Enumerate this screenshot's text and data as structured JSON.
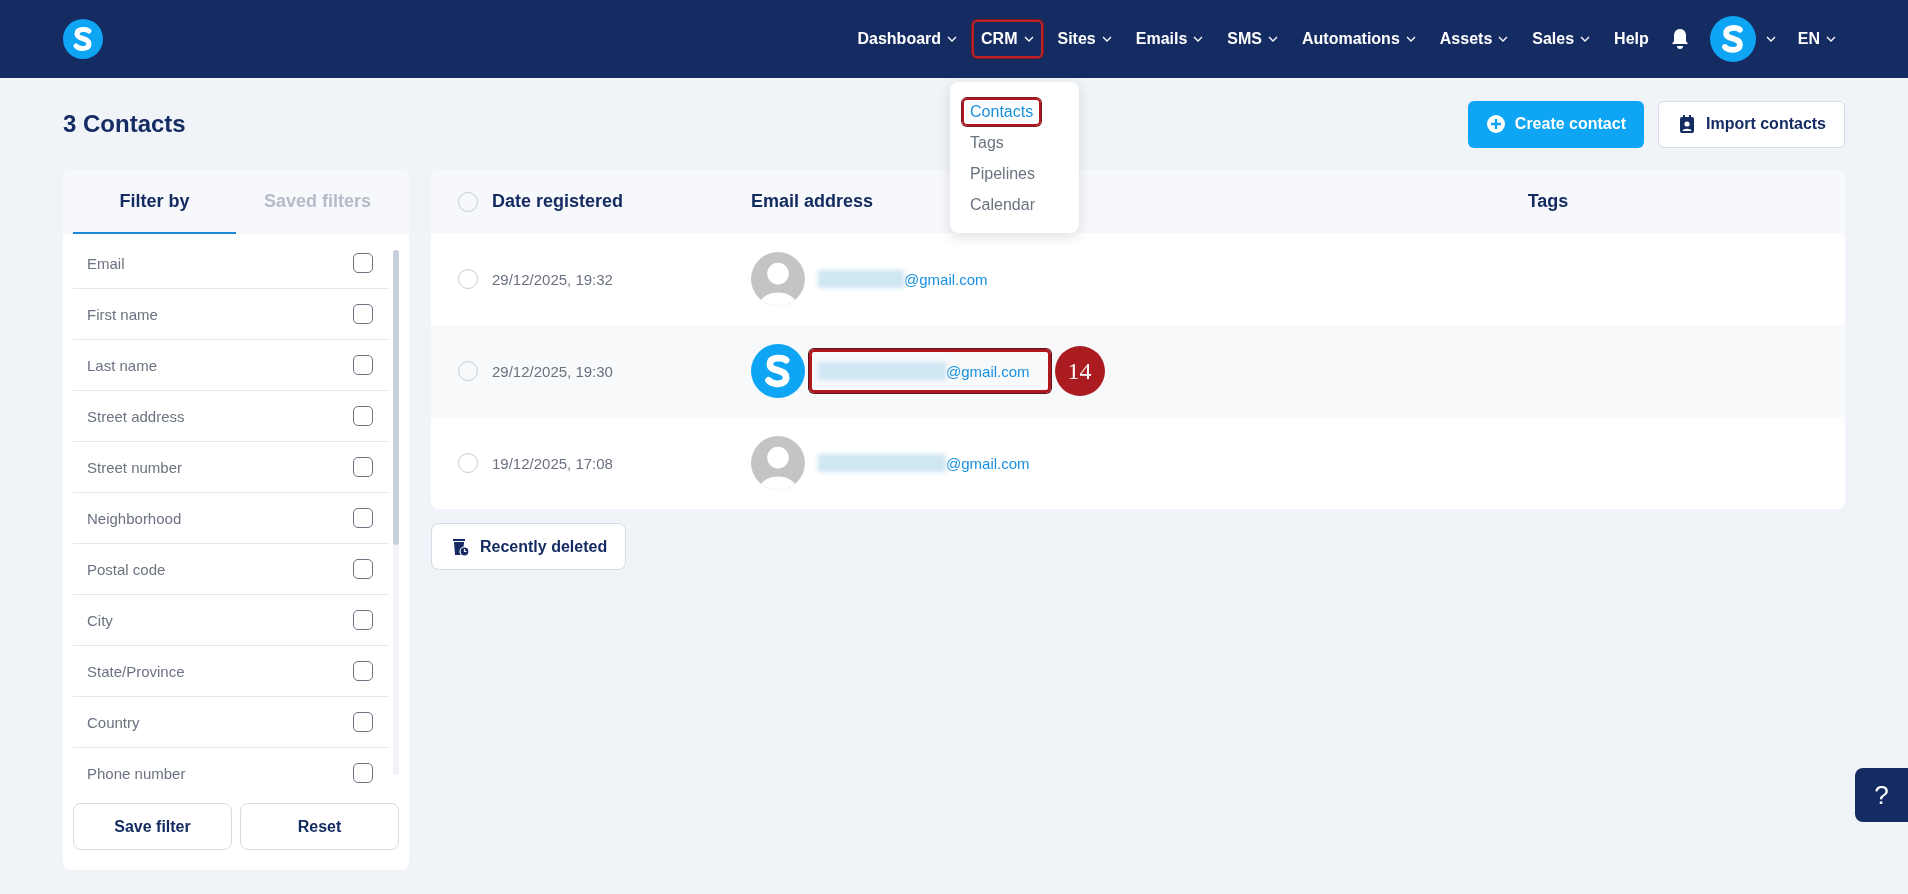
{
  "nav": {
    "items": [
      {
        "label": "Dashboard",
        "kind": "menu",
        "highlighted": false
      },
      {
        "label": "CRM",
        "kind": "menu",
        "highlighted": true
      },
      {
        "label": "Sites",
        "kind": "menu",
        "highlighted": false
      },
      {
        "label": "Emails",
        "kind": "menu",
        "highlighted": false
      },
      {
        "label": "SMS",
        "kind": "menu",
        "highlighted": false
      },
      {
        "label": "Automations",
        "kind": "menu",
        "highlighted": false
      },
      {
        "label": "Assets",
        "kind": "menu",
        "highlighted": false
      },
      {
        "label": "Sales",
        "kind": "menu",
        "highlighted": false
      },
      {
        "label": "Help",
        "kind": "link",
        "highlighted": false
      }
    ],
    "language": "EN"
  },
  "dropdown": {
    "items": [
      {
        "label": "Contacts",
        "selected": true,
        "highlighted": true
      },
      {
        "label": "Tags",
        "selected": false,
        "highlighted": false
      },
      {
        "label": "Pipelines",
        "selected": false,
        "highlighted": false
      },
      {
        "label": "Calendar",
        "selected": false,
        "highlighted": false
      }
    ]
  },
  "page_title": "3 Contacts",
  "buttons": [
    {
      "label": "Create contact",
      "kind": "primary"
    },
    {
      "label": "Import contacts",
      "kind": "secondary"
    }
  ],
  "filter_panel": {
    "tabs": [
      {
        "label": "Filter by",
        "selected": true
      },
      {
        "label": "Saved filters",
        "selected": false
      }
    ],
    "fields": [
      {
        "label": "Email",
        "checked": false
      },
      {
        "label": "First name",
        "checked": false
      },
      {
        "label": "Last name",
        "checked": false
      },
      {
        "label": "Street address",
        "checked": false
      },
      {
        "label": "Street number",
        "checked": false
      },
      {
        "label": "Neighborhood",
        "checked": false
      },
      {
        "label": "Postal code",
        "checked": false
      },
      {
        "label": "City",
        "checked": false
      },
      {
        "label": "State/Province",
        "checked": false
      },
      {
        "label": "Country",
        "checked": false
      },
      {
        "label": "Phone number",
        "checked": false
      }
    ],
    "actions": [
      "Save filter",
      "Reset"
    ]
  },
  "table": {
    "columns": [
      "Date registered",
      "Email address",
      "Tags"
    ],
    "all_selected": false,
    "rows": [
      {
        "date": "29/12/2025, 19:32",
        "kind": "placeholder",
        "email": "@gmail.com",
        "highlighted": false,
        "selected": false
      },
      {
        "date": "29/12/2025, 19:30",
        "kind": "logo",
        "email": "@gmail.com",
        "highlighted": true,
        "selected": false
      },
      {
        "date": "19/12/2025, 17:08",
        "kind": "placeholder",
        "email": "@gmail.com",
        "highlighted": false,
        "selected": false
      }
    ]
  },
  "recently_deleted": "Recently deleted",
  "annotation": "14",
  "help_button": "?"
}
